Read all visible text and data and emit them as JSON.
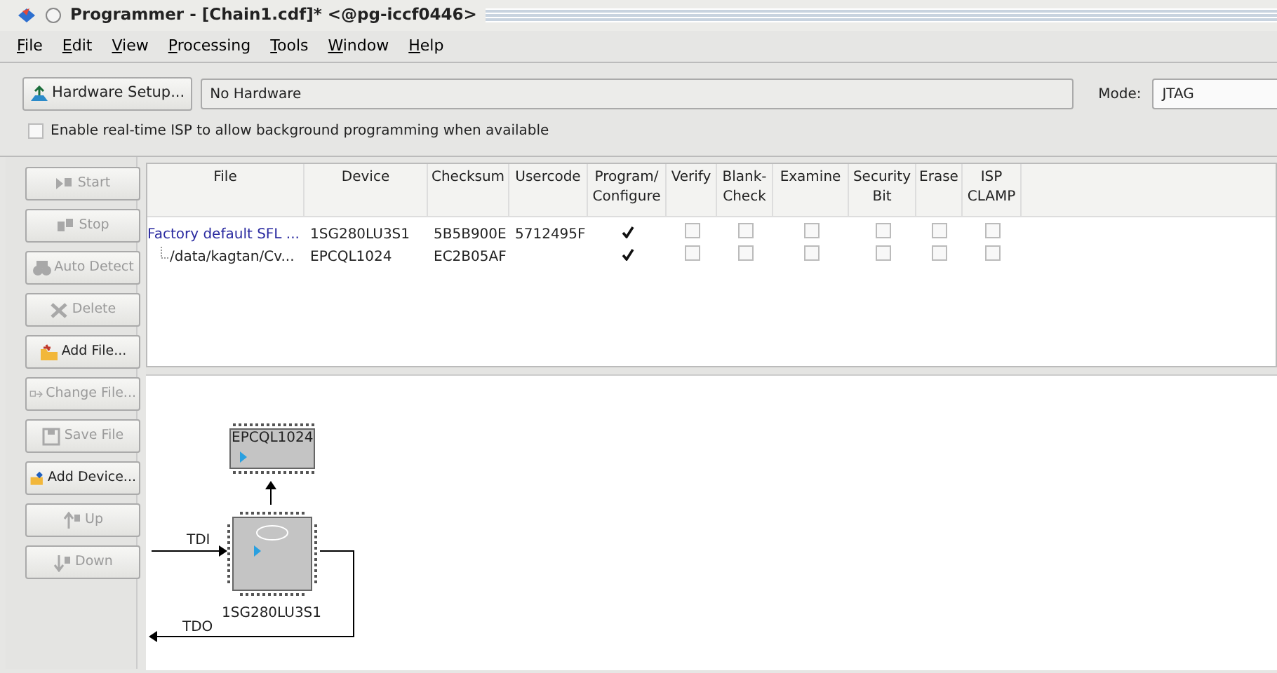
{
  "window": {
    "title": "Programmer - [Chain1.cdf]* <@pg-iccf0446>"
  },
  "menu": [
    {
      "label": "File"
    },
    {
      "label": "Edit"
    },
    {
      "label": "View"
    },
    {
      "label": "Processing"
    },
    {
      "label": "Tools"
    },
    {
      "label": "Window"
    },
    {
      "label": "Help"
    }
  ],
  "hardware": {
    "button": "Hardware Setup...",
    "value": "No Hardware",
    "mode_label": "Mode:",
    "mode": "JTAG"
  },
  "realtime_isp": {
    "label": "Enable real-time ISP to allow background programming when available",
    "checked": false
  },
  "side_buttons": [
    {
      "label": "Start",
      "kind": "start",
      "disabled": true
    },
    {
      "label": "Stop",
      "kind": "stop",
      "disabled": true
    },
    {
      "label": "Auto Detect",
      "kind": "detect",
      "disabled": true
    },
    {
      "label": "Delete",
      "kind": "delete",
      "disabled": true
    },
    {
      "label": "Add File...",
      "kind": "addfile",
      "disabled": false
    },
    {
      "label": "Change File...",
      "kind": "change",
      "disabled": true
    },
    {
      "label": "Save File",
      "kind": "save",
      "disabled": true
    },
    {
      "label": "Add Device...",
      "kind": "adddevice",
      "disabled": false
    },
    {
      "label": "Up",
      "kind": "up",
      "disabled": true
    },
    {
      "label": "Down",
      "kind": "down",
      "disabled": true
    }
  ],
  "table": {
    "columns": [
      "File",
      "Device",
      "Checksum",
      "Usercode",
      "Program/ Configure",
      "Verify",
      "Blank- Check",
      "Examine",
      "Security Bit",
      "Erase",
      "ISP CLAMP"
    ],
    "rows": [
      {
        "file": "Factory default SFL ...",
        "device": "1SG280LU3S1",
        "checksum": "5B5B900E",
        "usercode": "5712495F",
        "options": [
          {
            "checked": true
          },
          {
            "checked": false
          },
          {
            "checked": false
          },
          {
            "checked": false
          },
          {
            "checked": false
          },
          {
            "checked": false
          },
          {
            "checked": false
          }
        ],
        "children": [
          {
            "file": "/data/kagtan/Cv...",
            "device": "EPCQL1024",
            "checksum": "EC2B05AF",
            "options": [
              {
                "checked": true
              },
              {
                "checked": false
              },
              {
                "checked": false
              },
              {
                "checked": false
              },
              {
                "checked": false
              },
              {
                "checked": false
              },
              {
                "checked": false
              }
            ]
          }
        ]
      }
    ]
  },
  "diagram": {
    "flash": {
      "name": "EPCQL1024"
    },
    "device": {
      "name": "1SG280LU3S1"
    },
    "tdi": "TDI",
    "tdo": "TDO"
  }
}
